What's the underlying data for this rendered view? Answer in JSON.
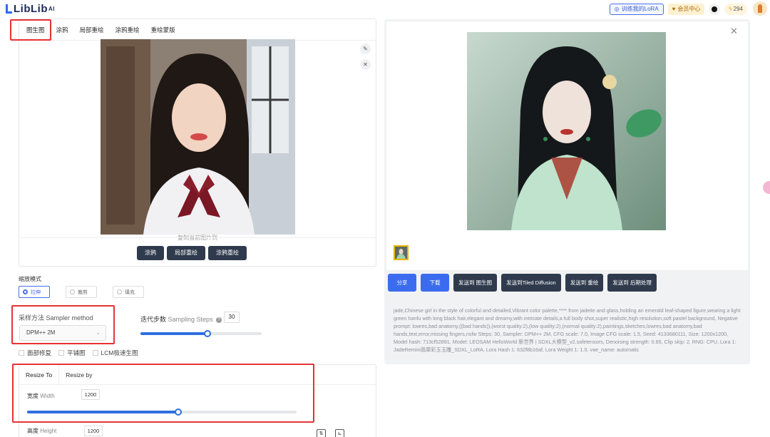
{
  "header": {
    "logo": "LibLib",
    "logo_sup": "AI",
    "train_lora": "训练我的LoRA",
    "member_center": "会员中心",
    "points": "294"
  },
  "editor": {
    "tabs": [
      {
        "label": "图生图"
      },
      {
        "label": "涂鸦"
      },
      {
        "label": "局部重绘"
      },
      {
        "label": "涂鸦重绘"
      },
      {
        "label": "重绘蒙版"
      }
    ],
    "copy_hint": "复制当前图片到",
    "copy_buttons": [
      {
        "label": "涂鸦"
      },
      {
        "label": "局部重绘"
      },
      {
        "label": "涂鸦重绘"
      }
    ]
  },
  "scale_mode": {
    "label": "缩放模式",
    "options": [
      {
        "label": "拉伸",
        "selected": true
      },
      {
        "label": "裁剪",
        "selected": false
      },
      {
        "label": "填充",
        "selected": false
      }
    ]
  },
  "sampler": {
    "label_cn": "采样方法",
    "label_en": "Sampler method",
    "value": "DPM++ 2M"
  },
  "steps": {
    "label_cn": "迭代步数",
    "label_en": "Sampling Steps",
    "value": "30",
    "fraction": 0.55
  },
  "options": [
    {
      "label": "面部修复"
    },
    {
      "label": "平铺图"
    },
    {
      "label": "LCM极速生图"
    }
  ],
  "resize": {
    "tabs": [
      {
        "label": "Resize To"
      },
      {
        "label": "Resize by"
      }
    ],
    "width_cn": "宽度",
    "width_en": "Width",
    "width_value": "1200",
    "width_fraction": 0.56,
    "height_cn": "高度",
    "height_en": "Height",
    "height_value": "1200"
  },
  "output": {
    "actions": [
      {
        "label": "分享"
      },
      {
        "label": "下载"
      },
      {
        "label": "发送到 图生图"
      },
      {
        "label": "发送到Tiled Diffusion"
      },
      {
        "label": "发送到 重绘"
      },
      {
        "label": "发送到 后期处理"
      }
    ],
    "info": "jade,Chinese girl in the style of colorful and detailed,Vibrant color palette,**** from jadeite and glass,holding an emerald leaf-shaped figure,wearing a light green hanfu with long black hair,elegant and dreamy,with intricate details,a full body shot,super realistic,high resolution,soft pastel background, Negative prompt: lowres,bad anatomy,((bad hands)),(worst quality:2),(low quality:2),(normal quality:2),paintings,sketches,lowres,bad anatomy,bad hands,text,error,missing fingers,nsfw Steps: 30, Sampler: DPM++ 2M, CFG scale: 7.0, Image CFG scale: 1.5, Seed: 4133680111, Size: 1200x1200, Model hash: 713cf52891, Model: LEOSAM HelloWorld 新世界 | SDXL大模型_v2.safetensors, Denoising strength: 0.65, Clip skip: 2, RNG: CPU, Lora 1: JadeRemini翡翠彩玉玉雕_SDXL_LoRA, Lora Hash 1: 632f8b16af, Lora Weight 1: 1.0, vae_name: automatic"
  },
  "colors": {
    "accent": "#2f6fe0",
    "dark_button": "#2f3a4d",
    "highlight_red": "#e53333"
  }
}
